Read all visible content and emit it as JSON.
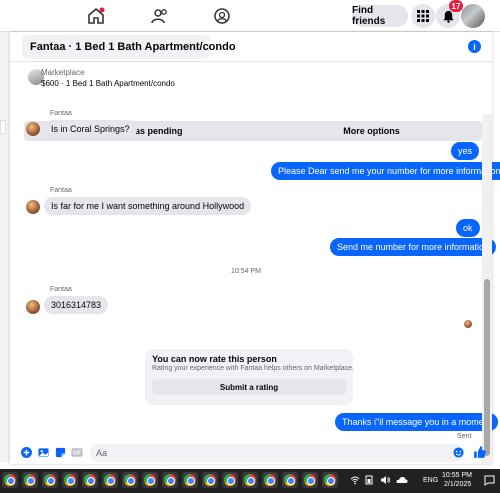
{
  "topbar": {
    "find_friends": "Find friends",
    "notification_count": "17",
    "icons": [
      "home-icon",
      "friends-icon",
      "groups-icon",
      "grid-menu-icon",
      "bell-icon"
    ]
  },
  "chat": {
    "title": "Fantaa · 1 Bed 1 Bath Apartment/condo",
    "marketplace_label": "Marketplace",
    "listing": "$600 · 1 Bed 1 Bath Apartment/condo",
    "mark_pending": "Mark as pending",
    "more_options": "More options",
    "top_cut_sender": "Fantaa",
    "messages": {
      "m1": "Is in Coral Springs?",
      "m2": "yes",
      "m3": "Please Dear send me your number for more information",
      "sender2": "Fantaa",
      "m4": "Is far for me I want something around Hollywood",
      "m5": "ok",
      "m6": "Send me number for more information",
      "time": "10:54 PM",
      "sender3": "Fantaa",
      "m7": "3016314783",
      "m8": "Thanks i\"il message you in a moment"
    },
    "rate": {
      "title": "You can now rate this person",
      "subtitle": "Rating your experience with Fantaa helps others on Marketplace.",
      "button": "Submit a rating"
    },
    "sent": "Sent",
    "composer_placeholder": "Aa"
  },
  "taskbar": {
    "lang": "ENG",
    "time": "10:55 PM",
    "date": "2/1/2025"
  },
  "colors": {
    "accent": "#0866ff",
    "bubble_in": "#e4e6eb",
    "badge": "#e41e3f"
  }
}
